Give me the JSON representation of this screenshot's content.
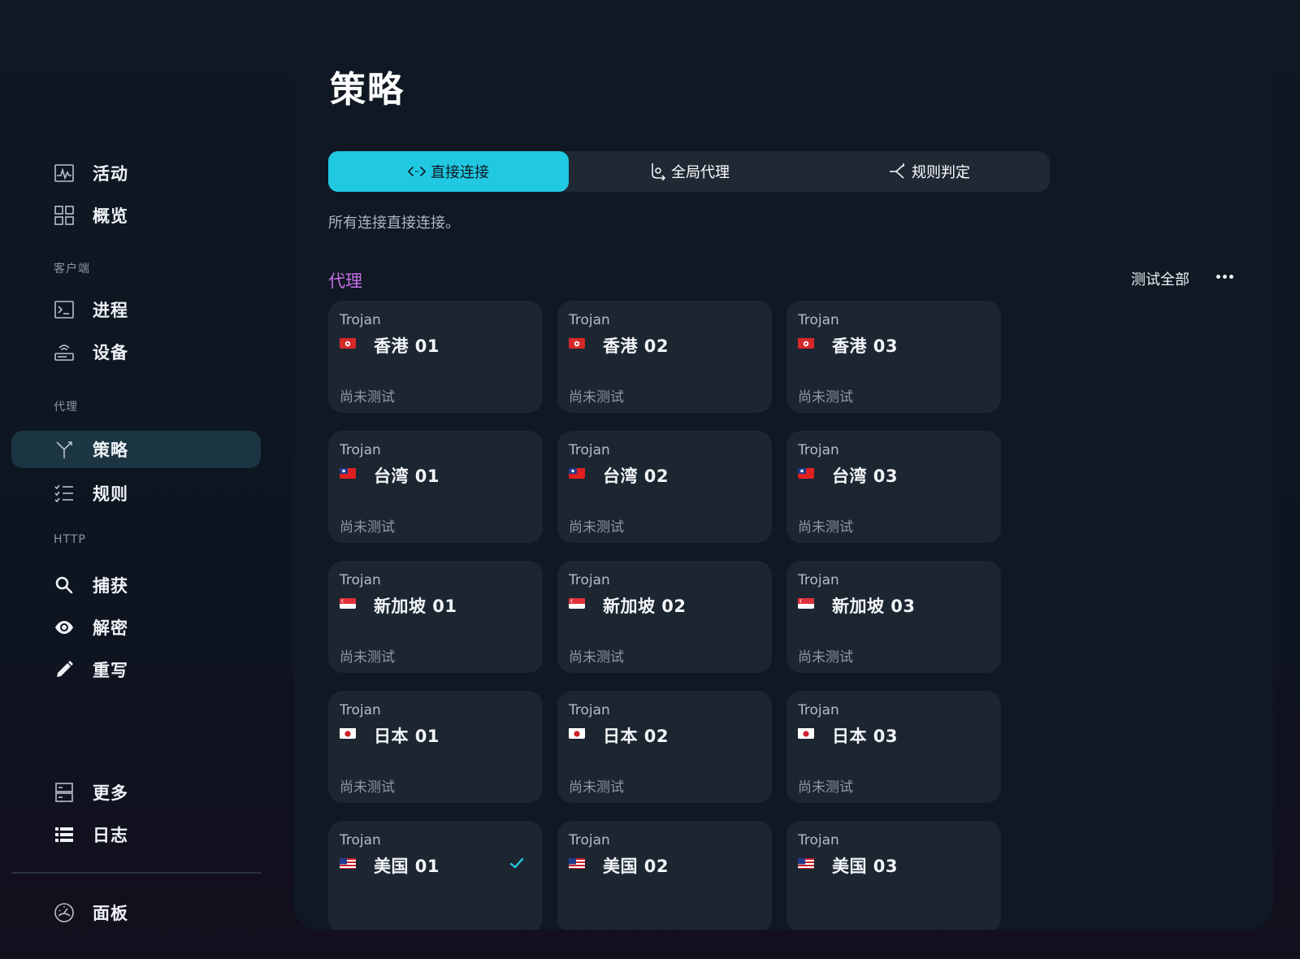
{
  "sidebar": {
    "items": [
      {
        "label": "活动",
        "icon": "activity-icon"
      },
      {
        "label": "概览",
        "icon": "grid-icon"
      },
      {
        "label": "进程",
        "icon": "terminal-icon"
      },
      {
        "label": "设备",
        "icon": "router-icon"
      },
      {
        "label": "策略",
        "icon": "branch-icon",
        "active": true
      },
      {
        "label": "规则",
        "icon": "checklist-icon"
      },
      {
        "label": "捕获",
        "icon": "search-icon"
      },
      {
        "label": "解密",
        "icon": "eye-icon"
      },
      {
        "label": "重写",
        "icon": "pencil-icon"
      },
      {
        "label": "更多",
        "icon": "server-icon"
      },
      {
        "label": "日志",
        "icon": "list-icon"
      },
      {
        "label": "面板",
        "icon": "dashboard-icon"
      }
    ],
    "sections": [
      "客户端",
      "代理",
      "HTTP"
    ]
  },
  "main": {
    "title": "策略",
    "modes": [
      {
        "label": "直接连接",
        "icon": "code-icon",
        "active": true
      },
      {
        "label": "全局代理",
        "icon": "global-route-icon"
      },
      {
        "label": "规则判定",
        "icon": "split-icon"
      }
    ],
    "mode_description": "所有连接直接连接。",
    "group_title": "代理",
    "test_all": "测试全部"
  },
  "proxies": [
    {
      "type": "Trojan",
      "name": "香港 01",
      "flag": "hk",
      "status": "尚未测试"
    },
    {
      "type": "Trojan",
      "name": "香港 02",
      "flag": "hk",
      "status": "尚未测试"
    },
    {
      "type": "Trojan",
      "name": "香港 03",
      "flag": "hk",
      "status": "尚未测试"
    },
    {
      "type": "Trojan",
      "name": "台湾 01",
      "flag": "tw",
      "status": "尚未测试"
    },
    {
      "type": "Trojan",
      "name": "台湾 02",
      "flag": "tw",
      "status": "尚未测试"
    },
    {
      "type": "Trojan",
      "name": "台湾 03",
      "flag": "tw",
      "status": "尚未测试"
    },
    {
      "type": "Trojan",
      "name": "新加坡 01",
      "flag": "sg",
      "status": "尚未测试"
    },
    {
      "type": "Trojan",
      "name": "新加坡 02",
      "flag": "sg",
      "status": "尚未测试"
    },
    {
      "type": "Trojan",
      "name": "新加坡 03",
      "flag": "sg",
      "status": "尚未测试"
    },
    {
      "type": "Trojan",
      "name": "日本 01",
      "flag": "jp",
      "status": "尚未测试"
    },
    {
      "type": "Trojan",
      "name": "日本 02",
      "flag": "jp",
      "status": "尚未测试"
    },
    {
      "type": "Trojan",
      "name": "日本 03",
      "flag": "jp",
      "status": "尚未测试"
    },
    {
      "type": "Trojan",
      "name": "美国 01",
      "flag": "us",
      "selected": true
    },
    {
      "type": "Trojan",
      "name": "美国 02",
      "flag": "us"
    },
    {
      "type": "Trojan",
      "name": "美国 03",
      "flag": "us"
    }
  ],
  "colors": {
    "accent": "#21c8e2",
    "group_title": "#c86ee8",
    "active_nav": "#1c3542",
    "card": "#1c2631"
  }
}
